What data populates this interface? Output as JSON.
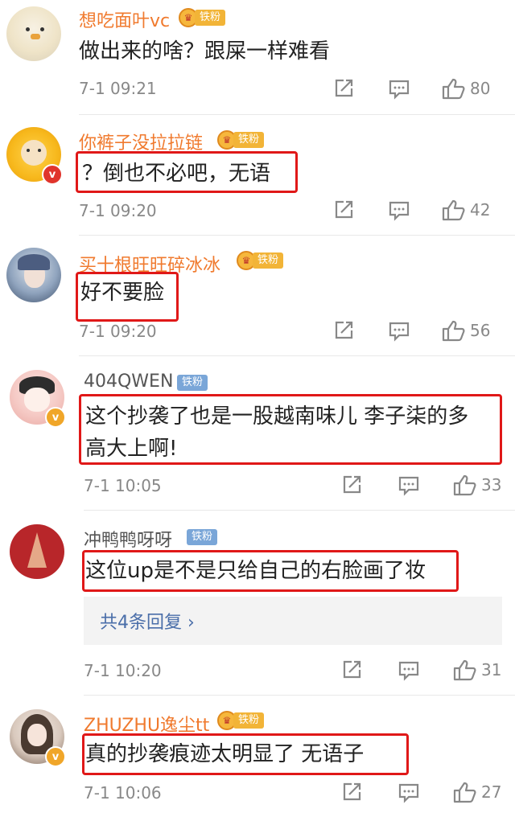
{
  "comments": [
    {
      "user": "想吃面叶vc",
      "badge": "铁粉",
      "text": "做出来的啥？跟屎一样难看",
      "time": "7-1 09:21",
      "likes": "80"
    },
    {
      "user": "你裤子没拉拉链",
      "badge": "铁粉",
      "text": "？倒也不必吧，无语",
      "time": "7-1 09:20",
      "likes": "42"
    },
    {
      "user": "买十根旺旺碎冰冰",
      "badge": "铁粉",
      "text": "好不要脸",
      "time": "7-1 09:20",
      "likes": "56"
    },
    {
      "user": "404QWEN",
      "badge": "铁粉",
      "text_line1": "这个抄袭了也是一股越南味儿  李子柒的多",
      "text_line2": "高大上啊!",
      "time": "7-1 10:05",
      "likes": "33"
    },
    {
      "user": "冲鸭鸭呀呀",
      "badge": "铁粉",
      "text": "这位up是不是只给自己的右脸画了妆",
      "replies": "共4条回复",
      "time": "7-1 10:20",
      "likes": "31"
    },
    {
      "user": "ZHUZHU逸尘tt",
      "badge": "铁粉",
      "text": "真的抄袭痕迹太明显了 无语子",
      "time": "7-1 10:06",
      "likes": "27"
    }
  ],
  "icons": {
    "share": "share-icon",
    "comment": "comment-icon",
    "like": "like-icon",
    "chevron": "chevron-right-icon",
    "verified": "verified-icon",
    "crown": "crown-icon"
  },
  "colors": {
    "username_highlight": "#f07a2e",
    "username_normal": "#555555",
    "red_box": "#e01818",
    "reply_link": "#4a6ea9"
  }
}
